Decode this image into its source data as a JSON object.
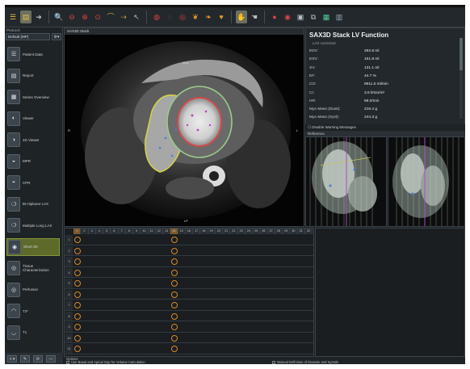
{
  "toolbar": {
    "icons": [
      "app-menu-icon",
      "document-icon",
      "arrow-right-icon",
      "zoom-icon",
      "zoom-minus-icon",
      "zoom-fit-icon",
      "zoom-region-icon",
      "measure-icon",
      "arrow-tool-icon",
      "pointer-icon",
      "contour-icon",
      "contour-edit-icon",
      "contour-copy-icon",
      "heart-lv-icon",
      "heart-rv-icon",
      "heart-both-icon",
      "active-tool-icon",
      "hand-icon",
      "record-icon",
      "target-icon",
      "save-icon",
      "export-icon",
      "layout-icon",
      "report-icon"
    ]
  },
  "protocol": {
    "label": "Protocol",
    "selected": "Default (MP)",
    "menu_glyph": "⚙▾"
  },
  "workflow": {
    "items": [
      {
        "label": "Patient Data",
        "icon": "patient-data-icon",
        "glyph": "☰",
        "active": false
      },
      {
        "label": "Report",
        "icon": "report-icon",
        "glyph": "▤",
        "active": false
      },
      {
        "label": "Series Overview",
        "icon": "series-overview-icon",
        "glyph": "▦",
        "active": false
      },
      {
        "label": "Viewer",
        "icon": "viewer-icon",
        "glyph": "◐",
        "active": false
      },
      {
        "label": "4D Viewer",
        "icon": "4d-viewer-icon",
        "glyph": "◑",
        "active": false
      },
      {
        "label": "MPR",
        "icon": "mpr-icon",
        "glyph": "◒",
        "active": false
      },
      {
        "label": "CPR",
        "icon": "cpr-icon",
        "glyph": "◓",
        "active": false
      },
      {
        "label": "Bi-Hiplanar LAX",
        "icon": "biplanar-lax-icon",
        "glyph": "❍",
        "active": false
      },
      {
        "label": "Multiple Long LAX",
        "icon": "multiple-lax-icon",
        "glyph": "❍",
        "active": false
      },
      {
        "label": "Short 3D",
        "icon": "short-3d-icon",
        "glyph": "◉",
        "active": true
      },
      {
        "label": "Tissue Characterization",
        "icon": "tissue-icon",
        "glyph": "◎",
        "active": false
      },
      {
        "label": "Perfusion",
        "icon": "perfusion-icon",
        "glyph": "◎",
        "active": false
      },
      {
        "label": "T2*",
        "icon": "t2star-icon",
        "glyph": "◠",
        "active": false
      },
      {
        "label": "T1",
        "icon": "t1-icon",
        "glyph": "◡",
        "active": false
      }
    ],
    "bottom_buttons": [
      "+ ▾",
      "✎",
      "⟳",
      "—"
    ]
  },
  "viewer": {
    "title": "SAX3D Stack",
    "orientation": {
      "top": "SLA",
      "left": "R",
      "bottom": "LP",
      "right": "L"
    }
  },
  "analysis": {
    "title": "SAX3D Stack LV Function",
    "subtitle": "LAX corrected",
    "metrics": [
      {
        "key": "EDV:",
        "value": "292.8 ml"
      },
      {
        "key": "ESV:",
        "value": "161.8 ml"
      },
      {
        "key": "SV:",
        "value": "131.1 ml"
      },
      {
        "key": "EF:",
        "value": "44.7 %"
      },
      {
        "key": "CO:",
        "value": "8911.5 ml/min"
      },
      {
        "key": "CI:",
        "value": "3.6 l/min/m²"
      },
      {
        "key": "HR:",
        "value": "68.0/min"
      },
      {
        "key": "Myo Mass (Diast):",
        "value": "216.4 g"
      },
      {
        "key": "Myo Mass (Syst):",
        "value": "244.3 g"
      }
    ],
    "warning_toggle": "Disable Warning Messages",
    "reference_label": "Reference"
  },
  "grid": {
    "columns": [
      "1",
      "2",
      "3",
      "4",
      "5",
      "6",
      "7",
      "8",
      "9",
      "10",
      "11",
      "12",
      "13",
      "14",
      "15",
      "16",
      "17",
      "18",
      "19",
      "20",
      "21",
      "22",
      "23",
      "24",
      "25",
      "26",
      "27",
      "28",
      "29",
      "30",
      "31",
      "32"
    ],
    "highlight_columns": [
      1,
      14
    ],
    "rows": [
      "1",
      "2",
      "3",
      "4",
      "5",
      "6",
      "7",
      "8",
      "9",
      "10",
      "11"
    ]
  },
  "options": {
    "label": "Options",
    "items": [
      {
        "label": "Use Basal and Apical Gap for Volume Calculation",
        "checked": false
      },
      {
        "label": "Manual Definition of Diastole and Systole",
        "checked": false
      }
    ]
  }
}
